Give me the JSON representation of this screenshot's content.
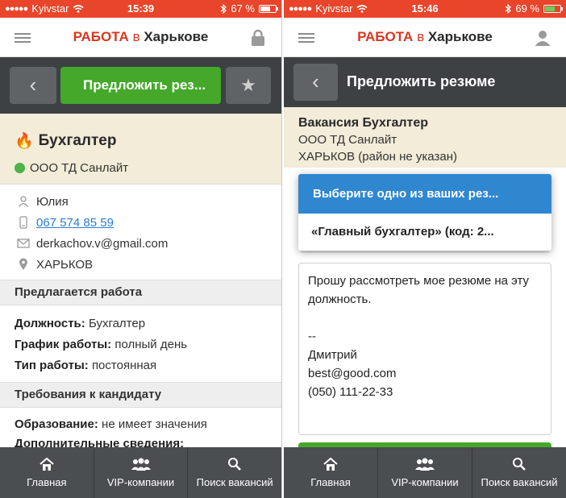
{
  "screens": [
    {
      "status": {
        "carrier": "Kyivstar",
        "time": "15:39",
        "battery": "67 %",
        "battery_level": 0.67
      },
      "header": {
        "brand_1": "РАБОТА",
        "brand_2": "в",
        "brand_3": "Харькове"
      },
      "toolbar": {
        "offer_label": "Предложить рез..."
      },
      "vacancy": {
        "title": "Бухгалтер",
        "company": "ООО ТД Санлайт"
      },
      "contacts": {
        "name": "Юлия",
        "phone": "067 574 85 59",
        "email": "derkachov.v@gmail.com",
        "city": "ХАРЬКОВ"
      },
      "work": {
        "heading": "Предлагается работа",
        "position_label": "Должность:",
        "position_value": "Бухгалтер",
        "schedule_label": "График работы:",
        "schedule_value": "полный день",
        "type_label": "Тип работы:",
        "type_value": "постоянная"
      },
      "requirements": {
        "heading": "Требования к кандидату",
        "education_label": "Образование:",
        "education_value": "не имеет значения",
        "extra_label": "Дополнительные сведения:"
      }
    },
    {
      "status": {
        "carrier": "Kyivstar",
        "time": "15:46",
        "battery": "69 %",
        "battery_level": 0.69
      },
      "header": {
        "brand_1": "РАБОТА",
        "brand_2": "в",
        "brand_3": "Харькове"
      },
      "toolbar": {
        "title": "Предложить резюме"
      },
      "vacancy": {
        "title": "Вакансия Бухгалтер",
        "company": "ООО ТД Санлайт",
        "location": "ХАРЬКОВ (район не указан)"
      },
      "resume_select": {
        "placeholder": "Выберите одно из ваших рез...",
        "option": "«Главный бухгалтер» (код: 2..."
      },
      "message": "Прошу рассмотреть мое резюме на эту должность.\n\n --\nДмитрий\nbest@good.com\n(050) 111-22-33"
    }
  ],
  "bottom_nav": [
    {
      "label": "Главная",
      "icon": "home-icon"
    },
    {
      "label": "VIP-компании",
      "icon": "users-icon"
    },
    {
      "label": "Поиск вакансий",
      "icon": "search-icon"
    }
  ],
  "colors": {
    "brand_red": "#e8452a",
    "toolbar_dark": "#3d4143",
    "accent_green": "#45a82b",
    "select_blue": "#2f87d0",
    "card_beige": "#f2ecd8"
  }
}
